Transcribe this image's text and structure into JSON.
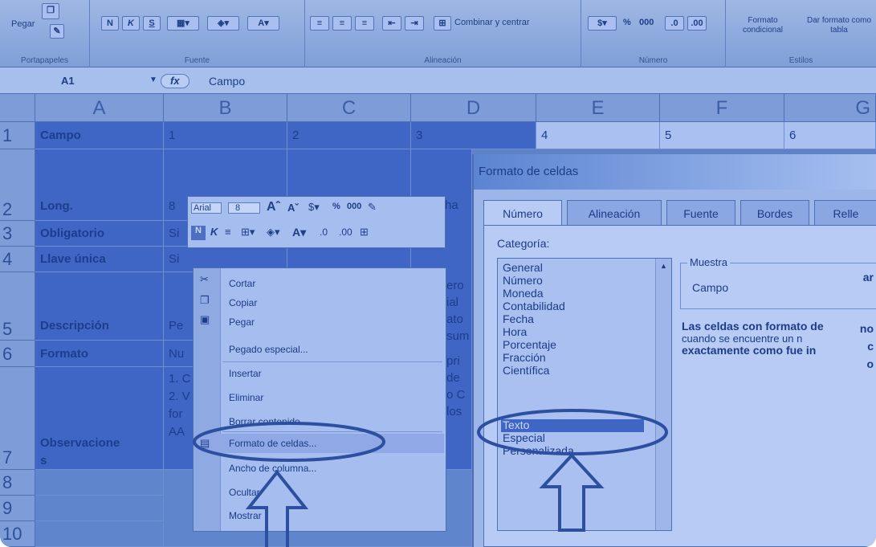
{
  "ribbon": {
    "groups": {
      "portapapeles": "Portapapeles",
      "fuente": "Fuente",
      "alineacion": "Alineación",
      "numero": "Número",
      "estilos": "Estilos"
    },
    "pegar": "Pegar",
    "combinar": "Combinar y centrar",
    "porcentaje": "%",
    "miles": "000",
    "formato_condicional": "Formato condicional",
    "dar_formato": "Dar formato como tabla"
  },
  "formula_bar": {
    "cell_ref": "A1",
    "fx": "fx",
    "value": "Campo"
  },
  "columns": [
    "A",
    "B",
    "C",
    "D",
    "E",
    "F",
    "G"
  ],
  "rows": [
    "1",
    "2",
    "3",
    "4",
    "5",
    "6",
    "7",
    "8",
    "9",
    "10"
  ],
  "cells": {
    "a1": "Campo",
    "b1": "1",
    "c1": "2",
    "d1": "3",
    "e1": "4",
    "f1": "5",
    "g1": "6",
    "a2": "Long.",
    "b2": "8",
    "a3": "Obligatorio",
    "b3": "Si",
    "a4": "Llave única",
    "b4": "Si",
    "a5": "Descripción",
    "b5": "Pe",
    "a6": "Formato",
    "b6": "Nu",
    "a7": "Observacione",
    "a7b": "s",
    "b7_1": "1. C",
    "b7_2": "2. V",
    "b7_3": "for",
    "b7_4": "AA"
  },
  "peek_text": [
    "ha",
    "ero",
    "ial",
    "ato",
    "sum",
    "pri",
    "de",
    "o C",
    "los"
  ],
  "right_edge_text": [
    "ar",
    "no",
    "c",
    "o"
  ],
  "mini_toolbar": {
    "font": "Arial",
    "size": "8",
    "percent": "%",
    "thousands": "000"
  },
  "context_menu": {
    "items": [
      "Cortar",
      "Copiar",
      "Pegar",
      "Pegado especial...",
      "Insertar",
      "Eliminar",
      "Borrar contenido",
      "Formato de celdas...",
      "Ancho de columna...",
      "Ocultar",
      "Mostrar"
    ]
  },
  "dialog": {
    "title": "Formato de celdas",
    "tabs": [
      "Número",
      "Alineación",
      "Fuente",
      "Bordes",
      "Relle"
    ],
    "categoria_label": "Categoría:",
    "categories": [
      "General",
      "Número",
      "Moneda",
      "Contabilidad",
      "Fecha",
      "Hora",
      "Porcentaje",
      "Fracción",
      "Científica",
      "Texto",
      "Especial",
      "Personalizada"
    ],
    "selected_category": "Texto",
    "muestra_label": "Muestra",
    "muestra_value": "Campo",
    "description": [
      "Las celdas con formato de",
      "cuando se encuentre un n",
      "exactamente como fue in"
    ]
  },
  "colors": {
    "accent": "#1f3f86",
    "selection": "#3f66c5",
    "annotation": "#2c4fa0"
  }
}
